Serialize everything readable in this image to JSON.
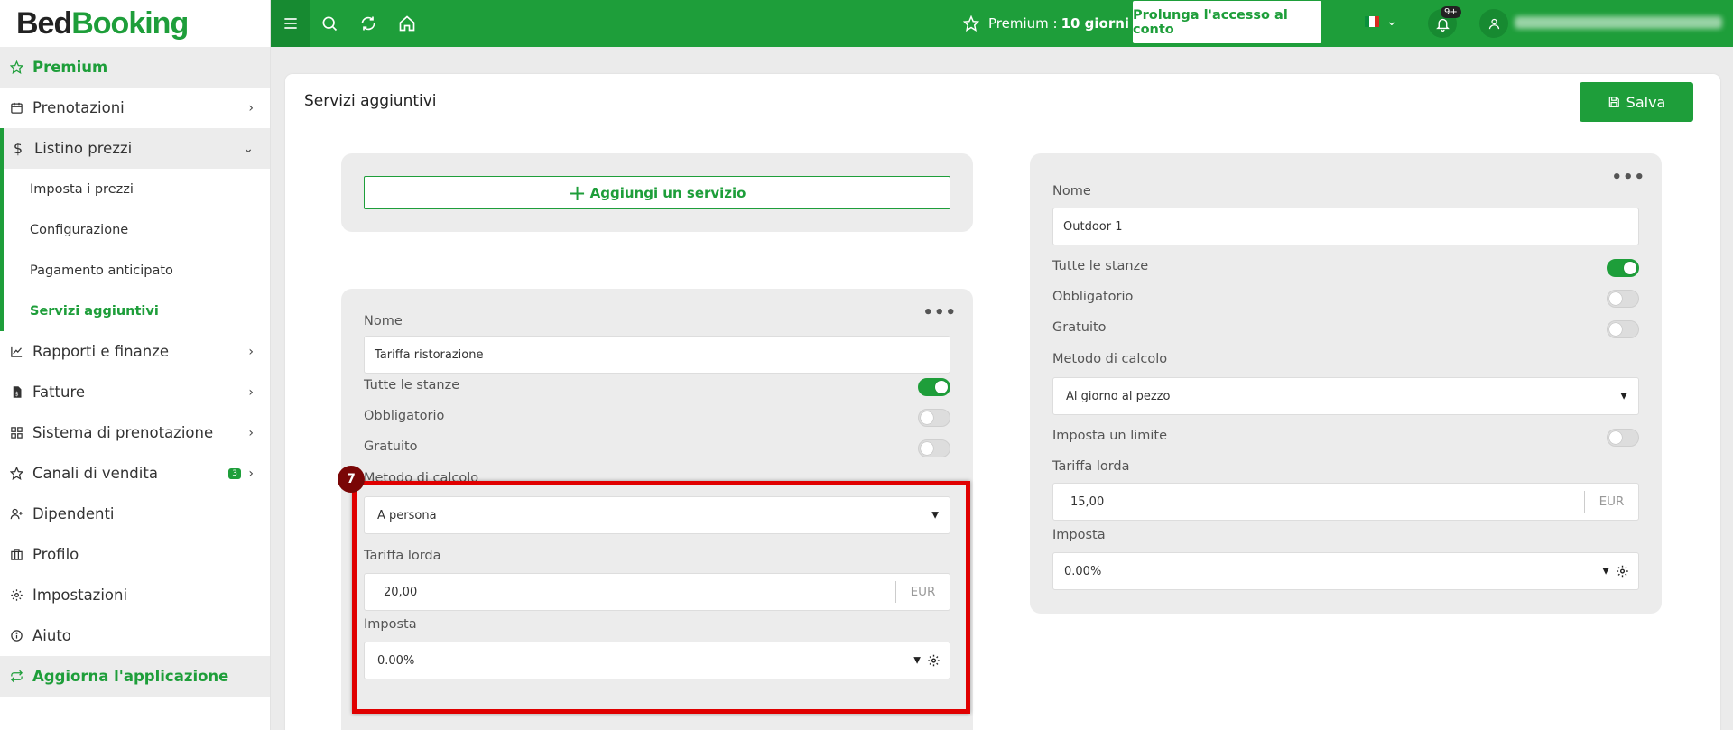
{
  "logo": {
    "part1": "Bed",
    "part2": "Booking"
  },
  "sidebar": {
    "premium": "Premium",
    "items": [
      {
        "label": "Prenotazioni"
      },
      {
        "label": "Listino prezzi"
      },
      {
        "label": "Rapporti e finanze"
      },
      {
        "label": "Fatture"
      },
      {
        "label": "Sistema di prenotazione"
      },
      {
        "label": "Canali di vendita",
        "badge": "3"
      },
      {
        "label": "Dipendenti"
      },
      {
        "label": "Profilo"
      },
      {
        "label": "Impostazioni"
      },
      {
        "label": "Aiuto"
      }
    ],
    "subitems": [
      {
        "label": "Imposta i prezzi"
      },
      {
        "label": "Configurazione"
      },
      {
        "label": "Pagamento anticipato"
      },
      {
        "label": "Servizi aggiuntivi"
      }
    ],
    "update": "Aggiorna l'applicazione"
  },
  "topbar": {
    "premium_label": "Premium :",
    "premium_days": "10 giorni",
    "extend_button": "Prolunga l'accesso al conto",
    "notifications_badge": "9+"
  },
  "page": {
    "title": "Servizi aggiuntivi",
    "save_label": "Salva",
    "add_service_label": "Aggiungi un servizio"
  },
  "service1": {
    "name_label": "Nome",
    "name_value": "Tariffa ristorazione",
    "all_rooms_label": "Tutte le stanze",
    "all_rooms": true,
    "mandatory_label": "Obbligatorio",
    "mandatory": false,
    "free_label": "Gratuito",
    "free": false,
    "calc_label": "Metodo di calcolo",
    "calc_value": "A persona",
    "rate_label": "Tariffa lorda",
    "rate_value": "20,00",
    "currency": "EUR",
    "tax_label": "Imposta",
    "tax_value": "0.00%"
  },
  "service2": {
    "name_label": "Nome",
    "name_value": "Outdoor 1",
    "all_rooms_label": "Tutte le stanze",
    "all_rooms": true,
    "mandatory_label": "Obbligatorio",
    "mandatory": false,
    "free_label": "Gratuito",
    "free": false,
    "calc_label": "Metodo di calcolo",
    "calc_value": "Al giorno al pezzo",
    "limit_label": "Imposta un limite",
    "limit": false,
    "rate_label": "Tariffa lorda",
    "rate_value": "15,00",
    "currency": "EUR",
    "tax_label": "Imposta",
    "tax_value": "0.00%"
  },
  "annotation": {
    "step": "7"
  },
  "colors": {
    "brand": "#1e9e3a",
    "highlight": "#e00000"
  }
}
